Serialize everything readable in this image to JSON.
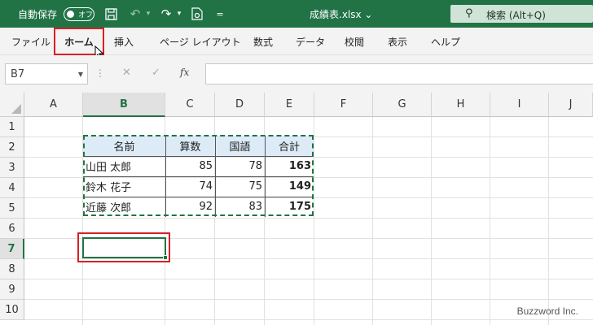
{
  "titlebar": {
    "autosave_label": "自動保存",
    "autosave_state": "オフ",
    "filename": "成績表.xlsx",
    "search_placeholder": "検索 (Alt+Q)"
  },
  "ribbon": {
    "tabs": [
      "ファイル",
      "ホーム",
      "挿入",
      "ページ レイアウト",
      "数式",
      "データ",
      "校閲",
      "表示",
      "ヘルプ"
    ]
  },
  "formula_bar": {
    "name_box": "B7",
    "fx": "fx",
    "value": ""
  },
  "sheet": {
    "columns": [
      "A",
      "B",
      "C",
      "D",
      "E",
      "F",
      "G",
      "H",
      "I",
      "J"
    ],
    "rows": [
      "1",
      "2",
      "3",
      "4",
      "5",
      "6",
      "7",
      "8",
      "9",
      "10"
    ],
    "selected_column": "B",
    "selected_row": "7"
  },
  "table": {
    "headers": [
      "名前",
      "算数",
      "国語",
      "合計"
    ],
    "rows": [
      [
        "山田 太郎",
        "85",
        "78",
        "163"
      ],
      [
        "鈴木 花子",
        "74",
        "75",
        "149"
      ],
      [
        "近藤 次郎",
        "92",
        "83",
        "175"
      ]
    ]
  },
  "watermark": "Buzzword Inc.",
  "colors": {
    "excel_green": "#217346",
    "highlight_red": "#d71f26",
    "header_fill": "#ddebf7"
  }
}
